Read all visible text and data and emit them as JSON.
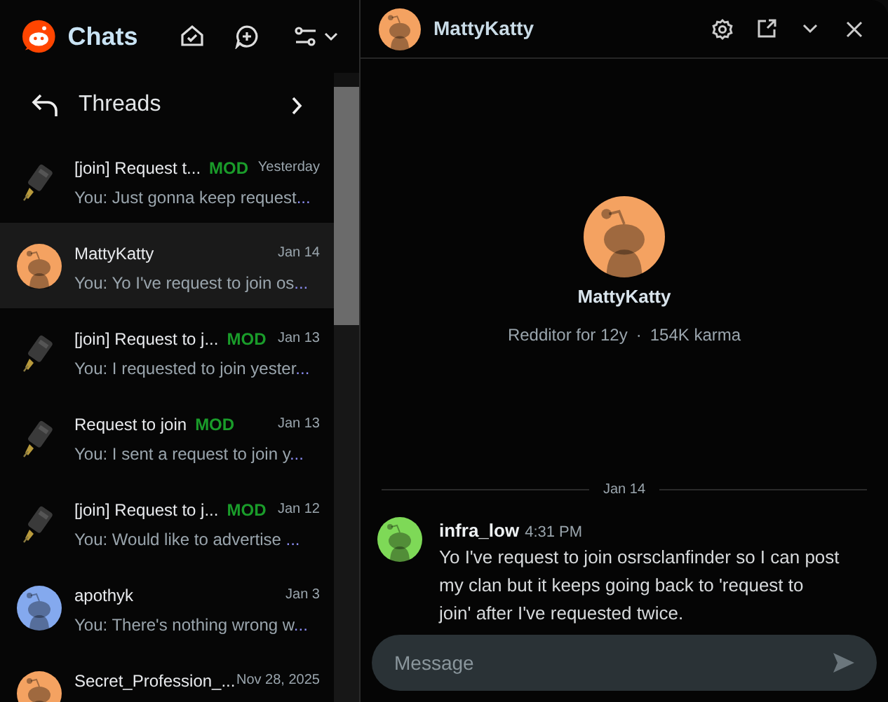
{
  "sidebar": {
    "title": "Chats",
    "section": {
      "label": "Threads"
    },
    "threads": [
      {
        "name": "[join] Request t...",
        "mod": "MOD",
        "date": "Yesterday",
        "preview": "You: Just gonna keep request",
        "ellipsis": "...",
        "selected": false
      },
      {
        "name": "MattyKatty",
        "date": "Jan 14",
        "preview": "You: Yo I've request to join os",
        "ellipsis": "...",
        "avatar": {
          "kind": "snoo",
          "color": "#f4a261"
        },
        "selected": true
      },
      {
        "name": "[join] Request to j...",
        "mod": "MOD",
        "date": "Jan 13",
        "preview": "You: I requested to join yester",
        "ellipsis": "...",
        "selected": false
      },
      {
        "name": "Request to join",
        "mod": "MOD",
        "date": "Jan 13",
        "preview": "You: I sent a request to join y",
        "ellipsis": "...",
        "selected": false
      },
      {
        "name": "[join] Request to j...",
        "mod": "MOD",
        "date": "Jan 12",
        "preview": "You: Would like to advertise ",
        "ellipsis": "...",
        "selected": false
      },
      {
        "name": "apothyk",
        "date": "Jan 3",
        "preview": "You: There's nothing wrong w",
        "ellipsis": "...",
        "avatar": {
          "kind": "snoo",
          "color": "#84a9ee"
        },
        "selected": false
      },
      {
        "name": "Secret_Profession_...",
        "date": "Nov 28, 2025",
        "avatar": {
          "kind": "snoo",
          "color": "#f4a261"
        },
        "selected": false
      }
    ]
  },
  "chat": {
    "title": "MattyKatty",
    "profile": {
      "name": "MattyKatty",
      "age": "Redditor for 12y",
      "separator": "·",
      "karma": "154K karma"
    },
    "date_divider": "Jan 14",
    "messages": [
      {
        "author": "infra_low",
        "time": "4:31 PM",
        "text": "Yo I've request to join osrsclanfinder so I can post my clan but it keeps going back to 'request to join' after I've requested twice."
      }
    ],
    "composer": {
      "placeholder": "Message"
    }
  }
}
